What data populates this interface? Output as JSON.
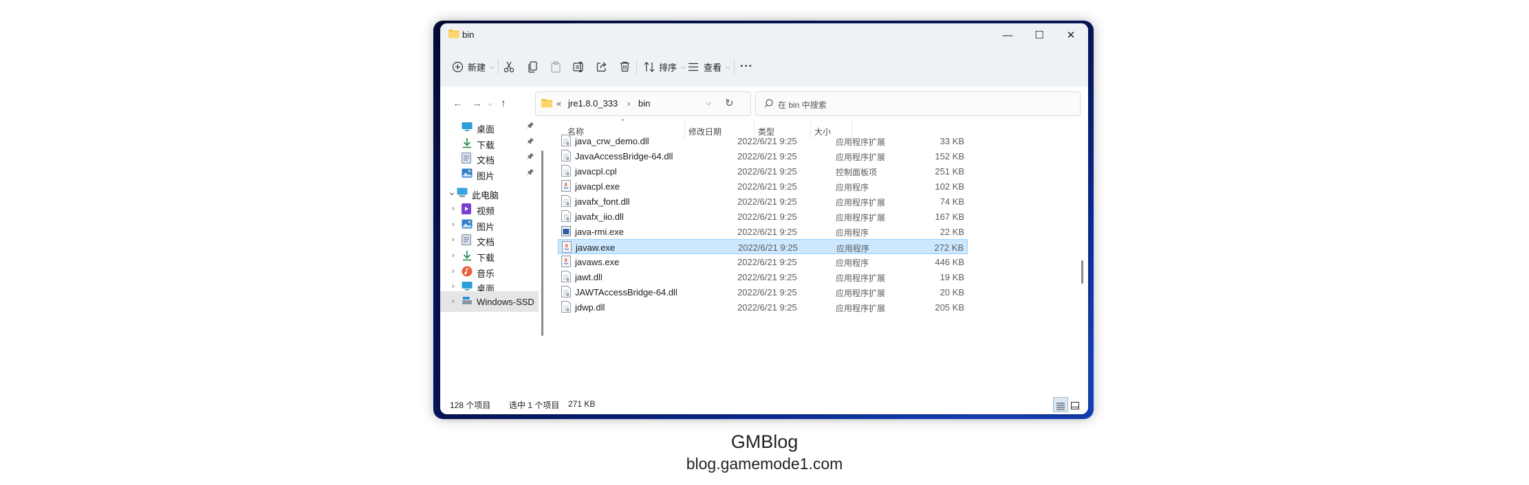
{
  "window": {
    "title": "bin"
  },
  "window_controls": {
    "minimize": "—",
    "maximize": "☐",
    "close": "✕"
  },
  "toolbar": {
    "new_label": "新建",
    "sort_label": "排序",
    "view_label": "查看",
    "more_label": "···"
  },
  "address": {
    "overflow": "«",
    "segment1": "jre1.8.0_333",
    "chevron": "›",
    "segment2": "bin",
    "search_placeholder": "在 bin 中搜索"
  },
  "sidebar": {
    "items": [
      {
        "label": "桌面",
        "icon": "desktop-icon",
        "pinned": true
      },
      {
        "label": "下载",
        "icon": "download-icon",
        "pinned": true
      },
      {
        "label": "文档",
        "icon": "document-icon",
        "pinned": true
      },
      {
        "label": "图片",
        "icon": "picture-icon",
        "pinned": true
      },
      {
        "label": "此电脑",
        "icon": "computer-icon",
        "expanded": true
      },
      {
        "label": "视频",
        "icon": "video-icon"
      },
      {
        "label": "图片",
        "icon": "picture-icon"
      },
      {
        "label": "文档",
        "icon": "document-icon"
      },
      {
        "label": "下载",
        "icon": "download-icon"
      },
      {
        "label": "音乐",
        "icon": "music-icon"
      },
      {
        "label": "桌面",
        "icon": "desktop-icon"
      },
      {
        "label": "Windows-SSD",
        "icon": "drive-icon",
        "selected": true
      }
    ]
  },
  "columns": {
    "name": "名称",
    "date": "修改日期",
    "type": "类型",
    "size": "大小"
  },
  "files": [
    {
      "name": "java_crw_demo.dll",
      "date": "2022/6/21 9:25",
      "type": "应用程序扩展",
      "size": "33 KB",
      "kind": "dll"
    },
    {
      "name": "JavaAccessBridge-64.dll",
      "date": "2022/6/21 9:25",
      "type": "应用程序扩展",
      "size": "152 KB",
      "kind": "dll"
    },
    {
      "name": "javacpl.cpl",
      "date": "2022/6/21 9:25",
      "type": "控制面板项",
      "size": "251 KB",
      "kind": "dll"
    },
    {
      "name": "javacpl.exe",
      "date": "2022/6/21 9:25",
      "type": "应用程序",
      "size": "102 KB",
      "kind": "java-exe"
    },
    {
      "name": "javafx_font.dll",
      "date": "2022/6/21 9:25",
      "type": "应用程序扩展",
      "size": "74 KB",
      "kind": "dll"
    },
    {
      "name": "javafx_iio.dll",
      "date": "2022/6/21 9:25",
      "type": "应用程序扩展",
      "size": "167 KB",
      "kind": "dll"
    },
    {
      "name": "java-rmi.exe",
      "date": "2022/6/21 9:25",
      "type": "应用程序",
      "size": "22 KB",
      "kind": "exe"
    },
    {
      "name": "javaw.exe",
      "date": "2022/6/21 9:25",
      "type": "应用程序",
      "size": "272 KB",
      "kind": "java-exe",
      "selected": true
    },
    {
      "name": "javaws.exe",
      "date": "2022/6/21 9:25",
      "type": "应用程序",
      "size": "446 KB",
      "kind": "java-exe"
    },
    {
      "name": "jawt.dll",
      "date": "2022/6/21 9:25",
      "type": "应用程序扩展",
      "size": "19 KB",
      "kind": "dll"
    },
    {
      "name": "JAWTAccessBridge-64.dll",
      "date": "2022/6/21 9:25",
      "type": "应用程序扩展",
      "size": "20 KB",
      "kind": "dll"
    },
    {
      "name": "jdwp.dll",
      "date": "2022/6/21 9:25",
      "type": "应用程序扩展",
      "size": "205 KB",
      "kind": "dll"
    }
  ],
  "status": {
    "item_count": "128 个项目",
    "selected": "选中 1 个项目",
    "selected_size": "271 KB"
  },
  "caption": {
    "brand": "GMBlog",
    "url": "blog.gamemode1.com"
  },
  "colors": {
    "selection": "#cce8ff",
    "selection_border": "#99d1ff",
    "titlebar": "#eef1f6",
    "folder": "#f4c54a"
  }
}
